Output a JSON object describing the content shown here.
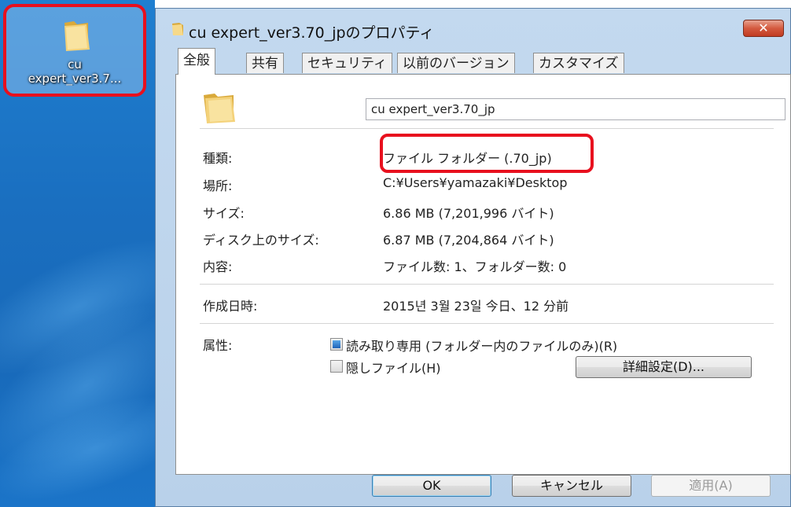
{
  "desktop": {
    "icon_label": "cu\nexpert_ver3.7..."
  },
  "window": {
    "title": "cu expert_ver3.70_jpのプロパティ",
    "close": "✕"
  },
  "tabs": [
    {
      "label": "全般"
    },
    {
      "label": "共有"
    },
    {
      "label": "セキュリティ"
    },
    {
      "label": "以前のバージョン"
    },
    {
      "label": "カスタマイズ"
    }
  ],
  "general": {
    "folder_name": "cu expert_ver3.70_jp",
    "type_label": "種類:",
    "type_value": "ファイル フォルダー (.70_jp)",
    "location_label": "場所:",
    "location_value": "C:¥Users¥yamazaki¥Desktop",
    "size_label": "サイズ:",
    "size_value": "6.86 MB (7,201,996 バイト)",
    "disk_size_label": "ディスク上のサイズ:",
    "disk_size_value": "6.87 MB (7,204,864 バイト)",
    "contents_label": "内容:",
    "contents_value": "ファイル数: 1、フォルダー数: 0",
    "created_label": "作成日時:",
    "created_value": "2015년 3월 23일 今日、12 分前",
    "attributes_label": "属性:",
    "readonly_label": "読み取り専用 (フォルダー内のファイルのみ)(R)",
    "hidden_label": "隠しファイル(H)",
    "advanced_button": "詳細設定(D)..."
  },
  "buttons": {
    "ok": "OK",
    "cancel": "キャンセル",
    "apply": "適用(A)"
  },
  "colors": {
    "highlight": "#e8101e",
    "desktop": "#1a6fc0",
    "frame": "#b9d1ea"
  }
}
